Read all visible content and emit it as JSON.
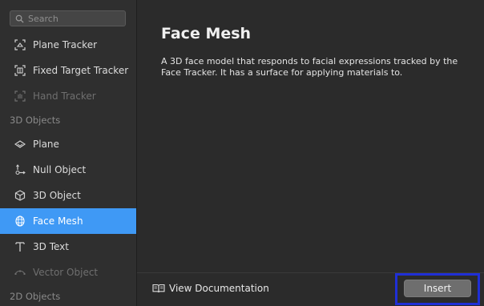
{
  "search": {
    "placeholder": "Search"
  },
  "sidebar": {
    "items": [
      {
        "label": "Plane Tracker",
        "icon": "plane-tracker-icon",
        "state": "normal"
      },
      {
        "label": "Fixed Target Tracker",
        "icon": "fixed-target-tracker-icon",
        "state": "normal"
      },
      {
        "label": "Hand Tracker",
        "icon": "hand-tracker-icon",
        "state": "disabled"
      }
    ],
    "section_3d": "3D Objects",
    "objects": [
      {
        "label": "Plane",
        "icon": "plane-icon",
        "state": "normal"
      },
      {
        "label": "Null Object",
        "icon": "null-object-icon",
        "state": "normal"
      },
      {
        "label": "3D Object",
        "icon": "cube-icon",
        "state": "normal"
      },
      {
        "label": "Face Mesh",
        "icon": "face-mesh-icon",
        "state": "selected"
      },
      {
        "label": "3D Text",
        "icon": "text-icon",
        "state": "normal"
      },
      {
        "label": "Vector Object",
        "icon": "vector-object-icon",
        "state": "disabled"
      }
    ],
    "section_2d": "2D Objects"
  },
  "detail": {
    "title": "Face Mesh",
    "description": "A 3D face model that responds to facial expressions tracked by the Face Tracker. It has a surface for applying materials to."
  },
  "footer": {
    "doc_label": "View Documentation",
    "insert_label": "Insert"
  },
  "colors": {
    "accent": "#3f99f5",
    "highlight_frame": "#1f2fd6"
  }
}
